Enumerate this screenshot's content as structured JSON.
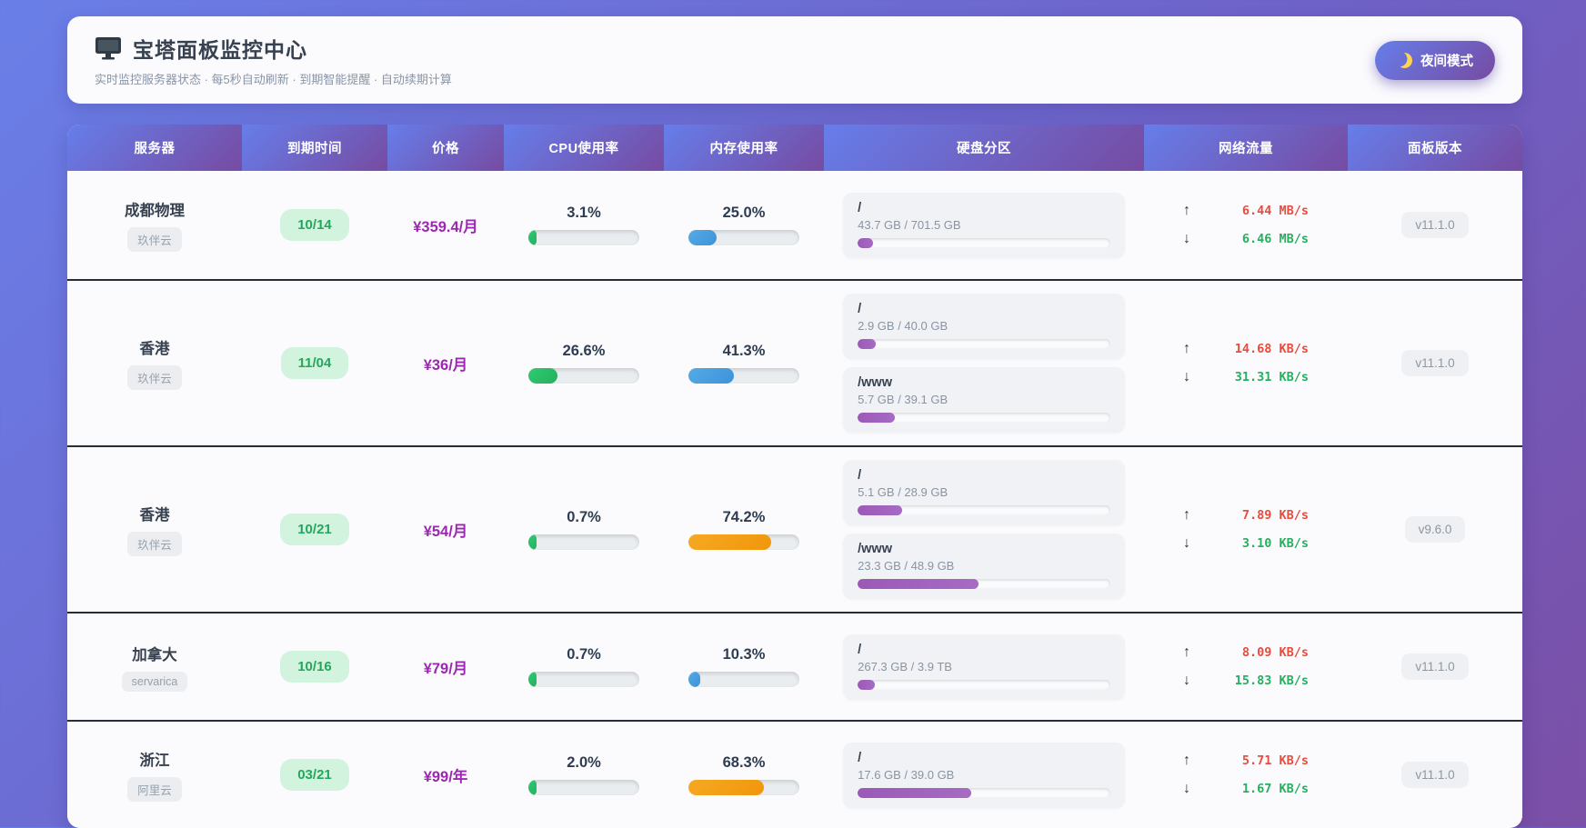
{
  "header": {
    "title": "宝塔面板监控中心",
    "subtitle": "实时监控服务器状态 · 每5秒自动刷新 · 到期智能提醒 · 自动续期计算",
    "night_mode_label": "夜间模式"
  },
  "icons": {
    "monitor": "monitor-icon",
    "moon": "moon-icon",
    "up_arrow": "↑",
    "down_arrow": "↓"
  },
  "colors": {
    "background_gradient_start": "#667eea",
    "background_gradient_end": "#764ba2",
    "cpu_bar": "#27ae60",
    "memory_bar_low": "#3b93d8",
    "memory_bar_high": "#f0960c",
    "disk_bar": "#9b59b6",
    "net_up": "#e74c3c",
    "net_down": "#27ae60",
    "price_text": "#9c27b0",
    "expiry_badge_bg": "#d2f3de",
    "expiry_badge_text": "#24a75c"
  },
  "table": {
    "columns": [
      "服务器",
      "到期时间",
      "价格",
      "CPU使用率",
      "内存使用率",
      "硬盘分区",
      "网络流量",
      "面板版本"
    ],
    "rows": [
      {
        "name": "成都物理",
        "provider": "玖伴云",
        "expiry": "10/14",
        "price": "¥359.4/月",
        "cpu": {
          "label": "3.1%",
          "pct": 3.1,
          "color": "fill-green"
        },
        "mem": {
          "label": "25.0%",
          "pct": 25.0,
          "color": "fill-blue"
        },
        "disks": [
          {
            "mount": "/",
            "usage": "43.7 GB / 701.5 GB",
            "pct": 6.2
          }
        ],
        "net_up": "6.44 MB/s",
        "net_down": "6.46 MB/s",
        "version": "v11.1.0"
      },
      {
        "name": "香港",
        "provider": "玖伴云",
        "expiry": "11/04",
        "price": "¥36/月",
        "cpu": {
          "label": "26.6%",
          "pct": 26.6,
          "color": "fill-green"
        },
        "mem": {
          "label": "41.3%",
          "pct": 41.3,
          "color": "fill-blue"
        },
        "disks": [
          {
            "mount": "/",
            "usage": "2.9 GB / 40.0 GB",
            "pct": 7.3
          },
          {
            "mount": "/www",
            "usage": "5.7 GB / 39.1 GB",
            "pct": 14.6
          }
        ],
        "net_up": "14.68 KB/s",
        "net_down": "31.31 KB/s",
        "version": "v11.1.0"
      },
      {
        "name": "香港",
        "provider": "玖伴云",
        "expiry": "10/21",
        "price": "¥54/月",
        "cpu": {
          "label": "0.7%",
          "pct": 0.7,
          "color": "fill-green"
        },
        "mem": {
          "label": "74.2%",
          "pct": 74.2,
          "color": "fill-orange"
        },
        "disks": [
          {
            "mount": "/",
            "usage": "5.1 GB / 28.9 GB",
            "pct": 17.6
          },
          {
            "mount": "/www",
            "usage": "23.3 GB / 48.9 GB",
            "pct": 47.7
          }
        ],
        "net_up": "7.89 KB/s",
        "net_down": "3.10 KB/s",
        "version": "v9.6.0"
      },
      {
        "name": "加拿大",
        "provider": "servarica",
        "expiry": "10/16",
        "price": "¥79/月",
        "cpu": {
          "label": "0.7%",
          "pct": 0.7,
          "color": "fill-green"
        },
        "mem": {
          "label": "10.3%",
          "pct": 10.3,
          "color": "fill-blue"
        },
        "disks": [
          {
            "mount": "/",
            "usage": "267.3 GB / 3.9 TB",
            "pct": 6.7
          }
        ],
        "net_up": "8.09 KB/s",
        "net_down": "15.83 KB/s",
        "version": "v11.1.0"
      },
      {
        "name": "浙江",
        "provider": "阿里云",
        "expiry": "03/21",
        "price": "¥99/年",
        "cpu": {
          "label": "2.0%",
          "pct": 2.0,
          "color": "fill-green"
        },
        "mem": {
          "label": "68.3%",
          "pct": 68.3,
          "color": "fill-orange"
        },
        "disks": [
          {
            "mount": "/",
            "usage": "17.6 GB / 39.0 GB",
            "pct": 45.1
          }
        ],
        "net_up": "5.71 KB/s",
        "net_down": "1.67 KB/s",
        "version": "v11.1.0"
      }
    ]
  }
}
